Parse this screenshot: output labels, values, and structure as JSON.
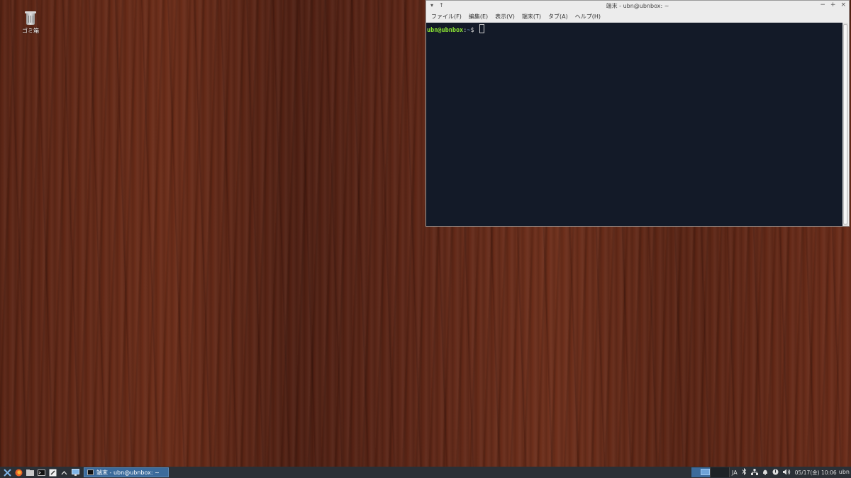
{
  "desktop": {
    "trash_label": "ゴミ箱"
  },
  "window": {
    "title": "端末 - ubn@ubnbox: ~",
    "menu": [
      "ファイル(F)",
      "編集(E)",
      "表示(V)",
      "端末(T)",
      "タブ(A)",
      "ヘルプ(H)"
    ],
    "controls": {
      "menu": "▾",
      "above": "↑",
      "minimize": "−",
      "maximize": "+",
      "close": "×"
    }
  },
  "terminal": {
    "user_host": "ubn@ubnbox",
    "separator": ":",
    "path": "~",
    "symbol": "$ "
  },
  "taskbar": {
    "task_label": "端末 - ubn@ubnbox: ~",
    "lang": "JA",
    "clock": "05/17(金) 10:06",
    "user": "ubn",
    "icons": [
      "xfce-menu-icon",
      "firefox-icon",
      "file-manager-icon",
      "terminal-icon",
      "text-editor-icon",
      "chevron-up-icon",
      "display-icon"
    ]
  }
}
